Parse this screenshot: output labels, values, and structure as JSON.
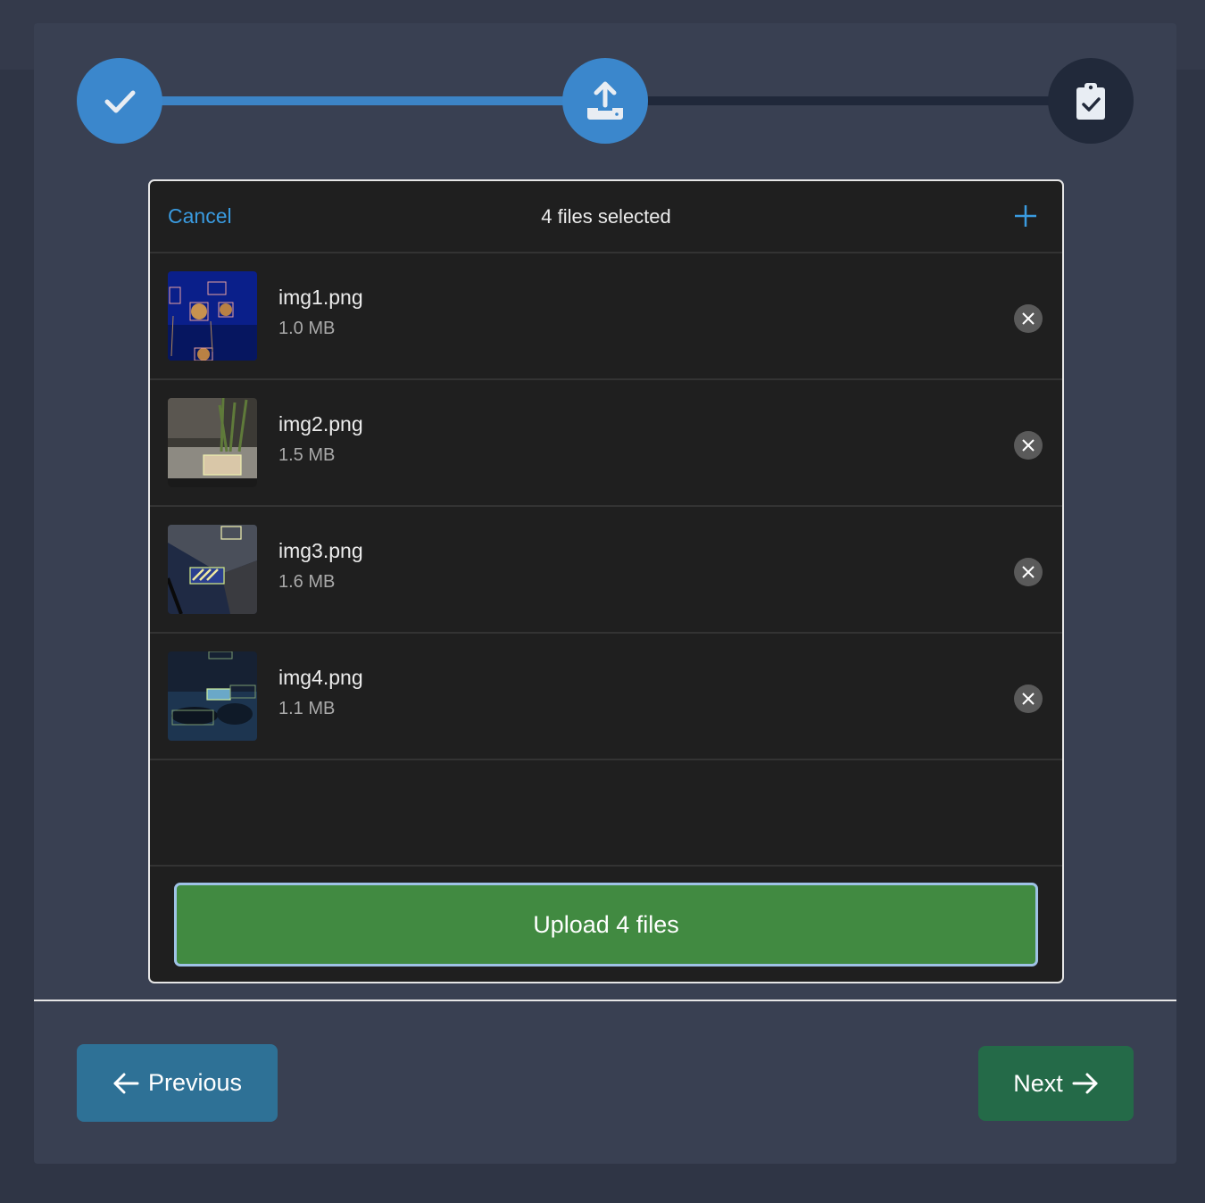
{
  "stepper": {
    "steps": [
      {
        "icon": "check-icon",
        "state": "completed"
      },
      {
        "icon": "upload-icon",
        "state": "active"
      },
      {
        "icon": "clipboard-check-icon",
        "state": "pending"
      }
    ],
    "colors": {
      "active": "#3b87cc",
      "pending": "#21293a"
    }
  },
  "uploader": {
    "cancel_label": "Cancel",
    "title": "4 files selected",
    "add_icon": "plus-icon",
    "files": [
      {
        "name": "img1.png",
        "size": "1.0 MB"
      },
      {
        "name": "img2.png",
        "size": "1.5 MB"
      },
      {
        "name": "img3.png",
        "size": "1.6 MB"
      },
      {
        "name": "img4.png",
        "size": "1.1 MB"
      }
    ],
    "upload_label": "Upload 4 files",
    "accent": "#3a9be0",
    "upload_color": "#418a41"
  },
  "nav": {
    "previous_label": "Previous",
    "next_label": "Next",
    "previous_color": "#2e7196",
    "next_color": "#246a48"
  }
}
